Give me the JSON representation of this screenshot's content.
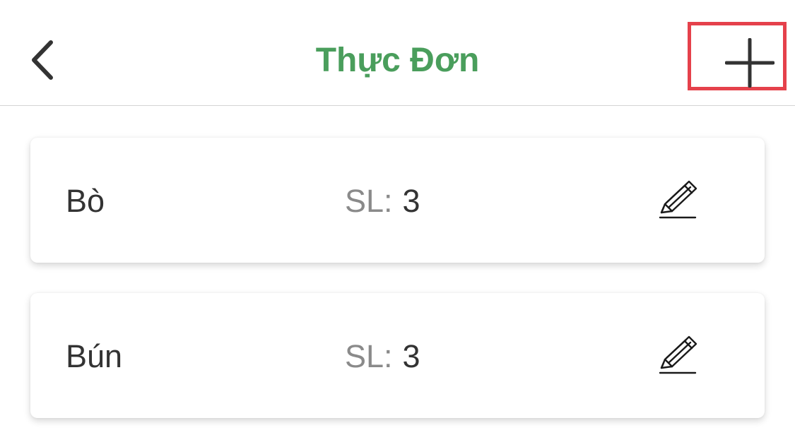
{
  "header": {
    "title": "Thực Đơn",
    "title_color": "#4a9e5c",
    "back_icon": "chevron-left-icon",
    "add_icon": "plus-icon",
    "highlight_color": "#e5414b"
  },
  "menu": {
    "qty_label": "SL:",
    "items": [
      {
        "name": "Bò",
        "qty": "3",
        "edit_icon": "pencil-icon"
      },
      {
        "name": "Bún",
        "qty": "3",
        "edit_icon": "pencil-icon"
      }
    ]
  }
}
